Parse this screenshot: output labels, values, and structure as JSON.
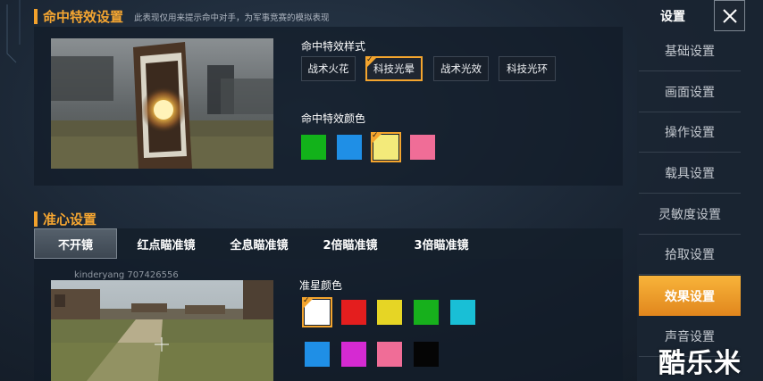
{
  "hit_effect": {
    "title": "命中特效设置",
    "subtitle": "此表现仅用来提示命中对手，为军事竞赛的模拟表现",
    "style_label": "命中特效样式",
    "styles": [
      {
        "label": "战术火花",
        "selected": false
      },
      {
        "label": "科技光晕",
        "selected": true
      },
      {
        "label": "战术光效",
        "selected": false
      },
      {
        "label": "科技光环",
        "selected": false
      }
    ],
    "color_label": "命中特效颜色",
    "colors": [
      {
        "color": "#12b21a",
        "selected": false
      },
      {
        "color": "#1f8fe6",
        "selected": false
      },
      {
        "color": "#f3ea7a",
        "selected": true
      },
      {
        "color": "#f06d97",
        "selected": false
      }
    ]
  },
  "crosshair": {
    "title": "准心设置",
    "tabs": [
      {
        "label": "不开镜",
        "active": true
      },
      {
        "label": "红点瞄准镜",
        "active": false
      },
      {
        "label": "全息瞄准镜",
        "active": false
      },
      {
        "label": "2倍瞄准镜",
        "active": false
      },
      {
        "label": "3倍瞄准镜",
        "active": false
      }
    ],
    "username": "kinderyang 707426556",
    "color_label": "准星颜色",
    "colors": [
      {
        "color": "#ffffff",
        "selected": true
      },
      {
        "color": "#e41e1e",
        "selected": false
      },
      {
        "color": "#e6d525",
        "selected": false
      },
      {
        "color": "#17b01c",
        "selected": false
      },
      {
        "color": "#19bfd6",
        "selected": false
      },
      {
        "color": "#1f8fe6",
        "selected": false
      },
      {
        "color": "#d52ad2",
        "selected": false
      },
      {
        "color": "#f06d97",
        "selected": false
      },
      {
        "color": "#050505",
        "selected": false
      }
    ]
  },
  "sidebar": {
    "title": "设置",
    "items": [
      {
        "label": "基础设置",
        "active": false
      },
      {
        "label": "画面设置",
        "active": false
      },
      {
        "label": "操作设置",
        "active": false
      },
      {
        "label": "载具设置",
        "active": false
      },
      {
        "label": "灵敏度设置",
        "active": false
      },
      {
        "label": "拾取设置",
        "active": false
      },
      {
        "label": "效果设置",
        "active": true
      },
      {
        "label": "声音设置",
        "active": false
      }
    ]
  },
  "brand": "酷乐米",
  "colors": {
    "accent": "#f4a52e"
  }
}
